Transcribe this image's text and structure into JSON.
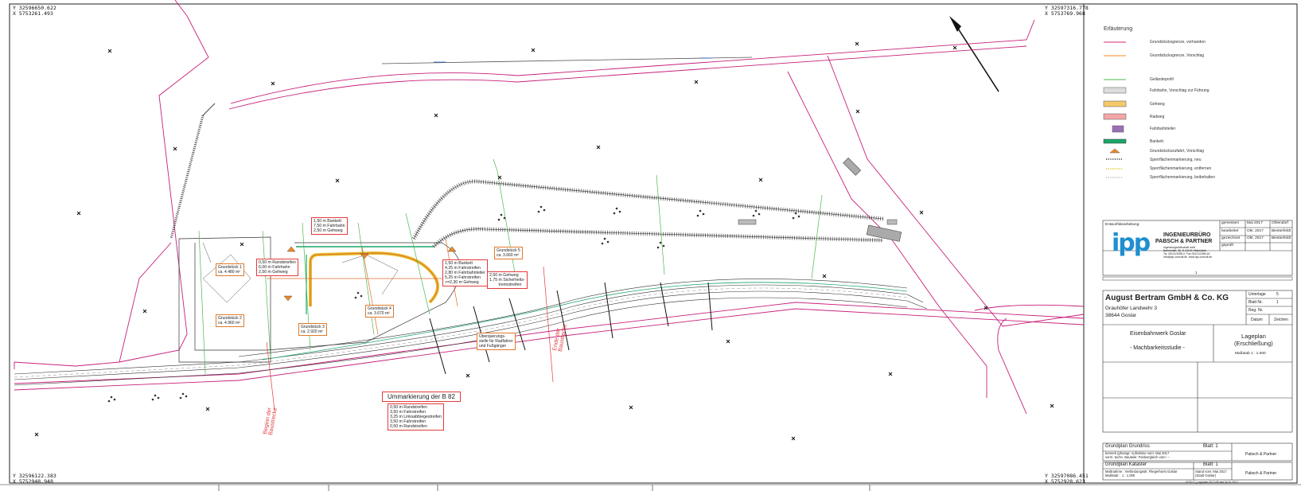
{
  "corners": {
    "top_left": "Y 32596650.622\nX 5753261.493",
    "top_right": "Y 32597316.778\nX 5753769.968",
    "bottom_left": "Y 32596122.383\nX 5752948.948",
    "bottom_right": "Y 32597086.451\nX 5752928.623"
  },
  "legend": {
    "title": "Erläuterung",
    "items": [
      {
        "label": "Grundstücksgrenze, vorhanden",
        "color": "#d0247a"
      },
      {
        "label": "Grundstücksgrenze, Vorschlag",
        "color": "#f08a24"
      },
      {
        "label": "Geländeprofil",
        "color": "#4bb84b"
      },
      {
        "label": "Fahrbahn, Vorschlag zur Führung",
        "color": "#dddddd"
      },
      {
        "label": "Gehweg",
        "color": "#f5c96a"
      },
      {
        "label": "Radweg",
        "color": "#f4a6a6"
      },
      {
        "label": "Fahrbahnteiler",
        "color": "#9b6fb5"
      },
      {
        "label": "Bankett",
        "color": "#1aa66a"
      },
      {
        "label": "Grundstückszufahrt, Vorschlag",
        "color": "#f08a24"
      },
      {
        "label": "Sperrflächenmarkierung, neu",
        "color": "#333333"
      },
      {
        "label": "Sperrflächenmarkierung, entfernen",
        "color": "#e8c020"
      },
      {
        "label": "Sperrflächenmarkierung, beibehalten",
        "color": "#bbbbbb"
      }
    ]
  },
  "office": {
    "heading": "Entwurfsbearbeitung:",
    "name_line1": "INGENIEURBÜRO",
    "name_line2": "PABSCH & PARTNER",
    "address": "Ingenieurgesellschaft mbH\nBahnhofstr. 36, D-31134 Hildesheim\nTel. 05121/2056-0, Fax 05121/2056-44\ninfo@ipp-consult.de  www.ipp-consult.de",
    "logo": "ipp",
    "rows": [
      [
        "gemessen",
        "Mai 2017",
        "Ohlendorf"
      ],
      [
        "bearbeitet",
        "Okt. 2017",
        "Biesterfeldt"
      ],
      [
        "gezeichnet",
        "Okt. 2017",
        "Biesterfeldt"
      ],
      [
        "geprüft",
        "",
        ""
      ]
    ],
    "page_index": "1"
  },
  "client": {
    "name": "August Bertram GmbH & Co. KG",
    "street": "Grauhöfer Landwehr 3",
    "city": "38644 Goslar",
    "unterlage_label": "Unterlage",
    "unterlage_value": "5",
    "blatt_label": "Blatt Nr.",
    "blatt_value": "1",
    "reg_label": "Reg. Nr.",
    "datum_label": "Datum",
    "zeichen_label": "Zeichen"
  },
  "project": {
    "line1": "Eisenbahnwerk Goslar",
    "line2": "- Machbarkeitsstudie -",
    "plan_title": "Lageplan",
    "plan_subtitle": "(Erschließung)",
    "scale": "Maßstab  1 : 1.000"
  },
  "basis": {
    "row1_title": "Grundplan Grundriss",
    "row1_blatt": "Blatt:  1",
    "row1_text": "bemerk (photogr. Aufnahme vom: Mai 2017\nverm. techn. Bauteile: Feldvergleich vom: --",
    "row1_right": "Pabsch & Partner",
    "row2_title": "Grundplan Kataster",
    "row2_blatt": "Blatt:  1",
    "row2_text": "Maßnahme : Verbindungsstr. Fliegerhorst Goslar\nMaßstab :  1 : 1.000",
    "row2_mid": "Stand vom: Mai 2017\n(Stadt Goslar)",
    "row2_right": "Pabsch & Partner",
    "file": "0153-17_Lageplan-2017-09.dwl    24.10.2017"
  },
  "labels": {
    "plot1": "Grundstück 1\nca. 4.480 m²",
    "plot2": "Grundstück 2\nca. 4.960 m²",
    "plot3": "Grundstück 3\nca. 2.920 m²",
    "plot4": "Grundstück 4\nca. 3.670 m²",
    "plot5": "Grundstück 5\nca. 3.660 m²",
    "sec_a": "1,50 m Bankett\n7,50 m Fahrbahn\n2,50 m Gehweg",
    "sec_b": "0,50 m Randstreifen\n6,00 m Fahrbahn\n2,50 m Gehweg",
    "sec_c": "1,50 m Bankett\n4,25 m Fahrstreifen\n2,80 m Fahrbahnteiler\n5,25 m Fahrstreifen\n>=2,30 m Gehweg",
    "sec_d": "2,50 m Gehweg\n1,75 m Sicherheits-\n        trennstreifen",
    "crossing": "Überquerungs-\nstelle für Radfahrer\nund Fußgänger",
    "b82_title": "Ummarkierung der B 82",
    "b82_lines": "0,50 m Randstreifen\n3,50 m Fahrstreifen\n3,25 m Linksabbiegestreifen\n3,50 m Fahrstreifen\n0,50 m Randstreifen",
    "v_start": "Beginn der\nBaustrecke",
    "v_end": "Ende der\nBaustrecke",
    "v_begin2": "Beginn der\nBaustrecke"
  }
}
